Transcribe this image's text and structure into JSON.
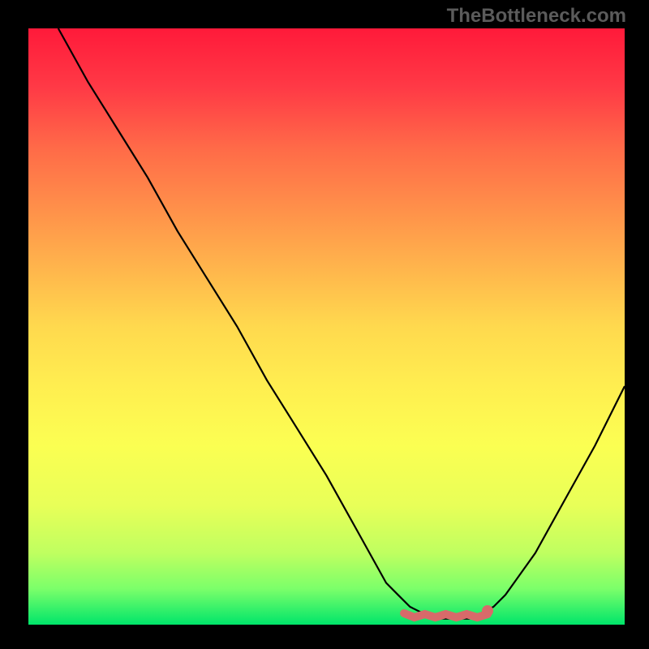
{
  "watermark": "TheBottleneck.com",
  "chart_data": {
    "type": "line",
    "title": "",
    "xlabel": "",
    "ylabel": "",
    "xlim": [
      0,
      100
    ],
    "ylim": [
      0,
      100
    ],
    "x": [
      5,
      10,
      15,
      20,
      25,
      30,
      35,
      40,
      45,
      50,
      55,
      60,
      62,
      64,
      66,
      68,
      70,
      72,
      74,
      76,
      78,
      80,
      85,
      90,
      95,
      100
    ],
    "values": [
      100,
      91,
      83,
      75,
      66,
      58,
      50,
      41,
      33,
      25,
      16,
      7,
      5,
      3,
      2,
      1,
      1,
      1,
      1,
      2,
      3,
      5,
      12,
      21,
      30,
      40
    ],
    "flat_zone": {
      "x_start": 63,
      "x_end": 77,
      "y": 1.5,
      "overlay_color": "#d86a6a"
    }
  }
}
